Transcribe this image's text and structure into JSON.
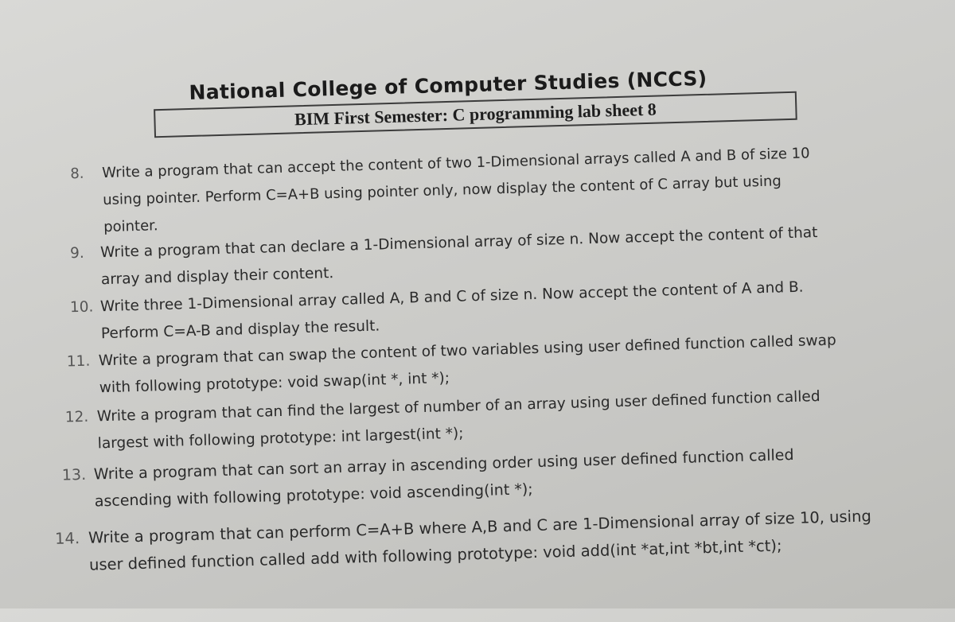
{
  "header": {
    "title": "National College of Computer Studies (NCCS)",
    "subtitle": "BIM First Semester: C programming lab sheet 8"
  },
  "exercises": [
    {
      "number": "8.",
      "lines": [
        "Write a program that can accept the content of two 1-Dimensional arrays called A and B of size 10",
        "using pointer. Perform C=A+B using pointer only, now display the content of C array but using",
        "pointer."
      ]
    },
    {
      "number": "9.",
      "lines": [
        "Write a program that can declare a 1-Dimensional array of size n. Now accept the content of that",
        "array and display their content."
      ]
    },
    {
      "number": "10.",
      "lines": [
        "Write three 1-Dimensional array called A, B and C of size n. Now accept the content of A and B.",
        "Perform C=A-B and display the result."
      ]
    },
    {
      "number": "11.",
      "lines": [
        "Write a program that can swap the content of two variables using user defined function called swap",
        "with following prototype: void swap(int *, int *);"
      ]
    },
    {
      "number": "12.",
      "lines": [
        "Write a program that can find the largest of number of an array using user defined function called",
        "largest with following prototype: int largest(int *);"
      ]
    },
    {
      "number": "13.",
      "lines": [
        "Write a program that can sort an array in ascending order using user defined function called",
        "ascending with following prototype: void ascending(int *);"
      ]
    },
    {
      "number": "14.",
      "lines": [
        "Write a program that can perform C=A+B where A,B and C are 1-Dimensional array of size 10, using",
        "user defined function called add with following prototype: void add(int *at,int *bt,int *ct);"
      ]
    }
  ]
}
